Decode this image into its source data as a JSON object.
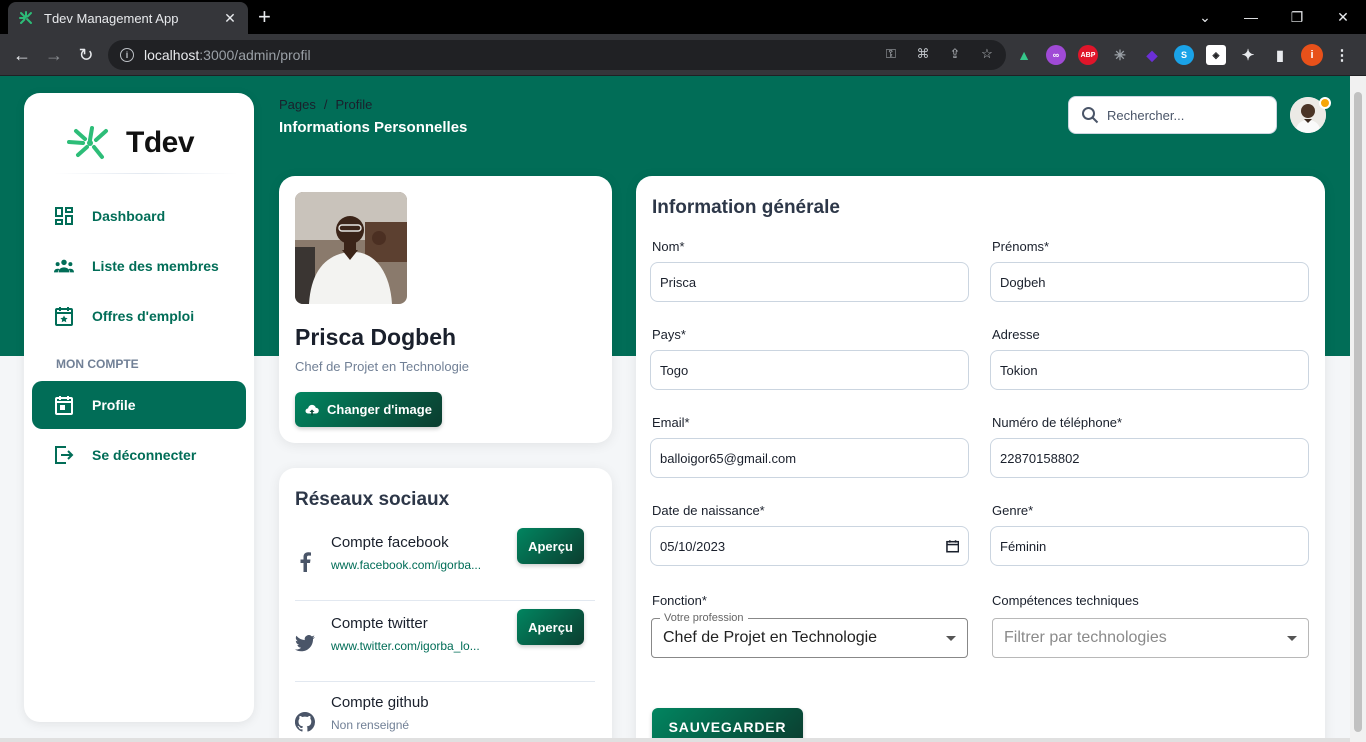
{
  "browser": {
    "tab_title": "Tdev Management App",
    "url_host": "localhost",
    "url_rest": ":3000/admin/profil",
    "profile_initial": "i",
    "ext_abp": "ABP"
  },
  "brand": {
    "name": "Tdev",
    "color": "#016d57",
    "accent": "#2dbd78"
  },
  "sidebar": {
    "items": [
      {
        "label": "Dashboard",
        "icon": "dashboard-icon"
      },
      {
        "label": "Liste des membres",
        "icon": "members-icon"
      },
      {
        "label": "Offres d'emploi",
        "icon": "calendar-star-icon"
      }
    ],
    "section_label": "MON COMPTE",
    "account_items": [
      {
        "label": "Profile",
        "icon": "calendar-icon",
        "active": true
      },
      {
        "label": "Se déconnecter",
        "icon": "logout-icon"
      }
    ]
  },
  "header": {
    "breadcrumb_root": "Pages",
    "breadcrumb_sep": "/",
    "breadcrumb_current": "Profile",
    "title": "Informations Personnelles",
    "search_placeholder": "Rechercher..."
  },
  "profile": {
    "name": "Prisca Dogbeh",
    "role": "Chef de Projet en Technologie",
    "change_image_label": "Changer d'image"
  },
  "social": {
    "title": "Réseaux sociaux",
    "accounts": [
      {
        "label": "Compte facebook",
        "link": "www.facebook.com/igorba...",
        "button": "Aperçu",
        "icon": "facebook-icon"
      },
      {
        "label": "Compte twitter",
        "link": "www.twitter.com/igorba_lo...",
        "button": "Aperçu",
        "icon": "twitter-icon"
      },
      {
        "label": "Compte github",
        "link": "Non renseigné",
        "icon": "github-icon"
      }
    ]
  },
  "form": {
    "title": "Information générale",
    "nom": {
      "label": "Nom*",
      "value": "Prisca"
    },
    "prenoms": {
      "label": "Prénoms*",
      "value": "Dogbeh"
    },
    "pays": {
      "label": "Pays*",
      "value": "Togo"
    },
    "adresse": {
      "label": "Adresse",
      "value": "Tokion"
    },
    "email": {
      "label": "Email*",
      "value": "balloigor65@gmail.com"
    },
    "telephone": {
      "label": "Numéro de téléphone*",
      "value": "22870158802"
    },
    "naissance": {
      "label": "Date de naissance*",
      "value": "05/10/2023"
    },
    "genre": {
      "label": "Genre*",
      "value": "Féminin"
    },
    "fonction": {
      "label": "Fonction*",
      "floating_label": "Votre profession",
      "value": "Chef de Projet en Technologie"
    },
    "competences": {
      "label": "Compétences techniques",
      "placeholder": "Filtrer par technologies"
    },
    "save_label": "SAUVEGARDER"
  }
}
